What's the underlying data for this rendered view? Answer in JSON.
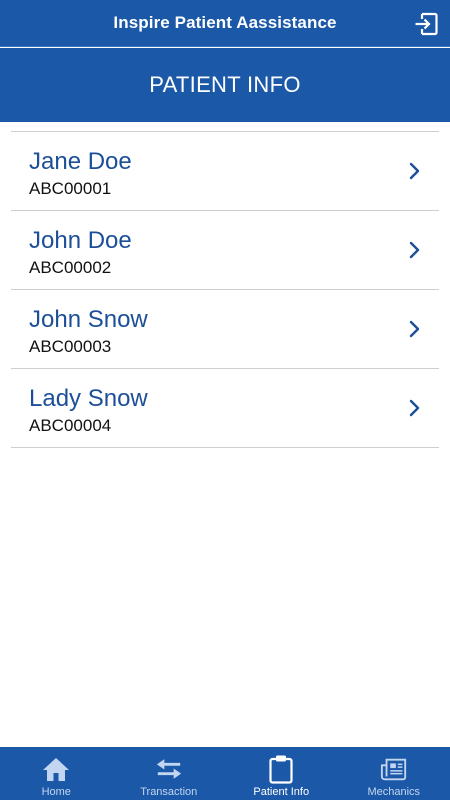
{
  "app": {
    "title": "Inspire Patient Aassistance",
    "logout_icon": "logout-icon"
  },
  "header": {
    "title": "PATIENT INFO"
  },
  "patients": [
    {
      "name": "Jane Doe",
      "id": "ABC00001"
    },
    {
      "name": "John Doe",
      "id": "ABC00002"
    },
    {
      "name": "John Snow",
      "id": "ABC00003"
    },
    {
      "name": "Lady Snow",
      "id": "ABC00004"
    }
  ],
  "tabs": [
    {
      "label": "Home",
      "icon": "home-icon",
      "active": false
    },
    {
      "label": "Transaction",
      "icon": "swap-arrows-icon",
      "active": false
    },
    {
      "label": "Patient Info",
      "icon": "clipboard-icon",
      "active": true
    },
    {
      "label": "Mechanics",
      "icon": "newspaper-icon",
      "active": false
    }
  ],
  "colors": {
    "primary": "#1b58a8",
    "name_text": "#1d4f99",
    "divider": "#cfcfcf",
    "tab_inactive": "#c3d6f1"
  }
}
